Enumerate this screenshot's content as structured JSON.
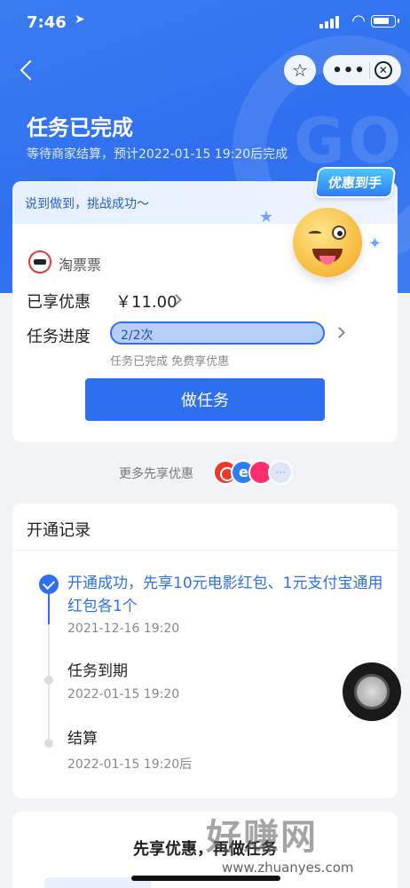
{
  "status_bar": {
    "time": "7:46",
    "location_icon": "location-arrow-icon"
  },
  "nav": {
    "back_icon": "back-chevron-icon",
    "favorite_icon": "star-icon",
    "more_icon": "more-dots-icon",
    "close_icon": "close-circle-icon",
    "more_label": "•••",
    "close_label": "✕"
  },
  "header": {
    "title": "任务已完成",
    "subtitle": "等待商家结算，预计2022-01-15 19:20后完成"
  },
  "task_card": {
    "slogan": "说到做到，挑战成功～",
    "badge": "优惠到手",
    "merchant": "淘票票",
    "discount_label": "已享优惠",
    "discount_value": "￥11.00",
    "progress_label": "任务进度",
    "progress_text": "2/2次",
    "progress_fraction": 1.0,
    "progress_note": "任务已完成 免费享优惠",
    "button": "做任务"
  },
  "more_benefits": {
    "label": "更多先享优惠",
    "more_icon_label": "···"
  },
  "record": {
    "title": "开通记录",
    "items": [
      {
        "text": "开通成功，先享10元电影红包、1元支付宝通用红包各1个",
        "time": "2021-12-16 19:20",
        "state": "done"
      },
      {
        "text": "任务到期",
        "time": "2022-01-15 19:20",
        "state": "pending"
      },
      {
        "text": "结算",
        "time": "2022-01-15 19:20后",
        "state": "pending"
      }
    ]
  },
  "bottom_card": {
    "title": "先享优惠，再做任务"
  },
  "watermark": {
    "text": "好赚网",
    "url": "www.zhuanyes.com"
  },
  "colors": {
    "primary": "#2e6ff0",
    "hero": "#3a7cf0",
    "background": "#f2f3f5"
  }
}
